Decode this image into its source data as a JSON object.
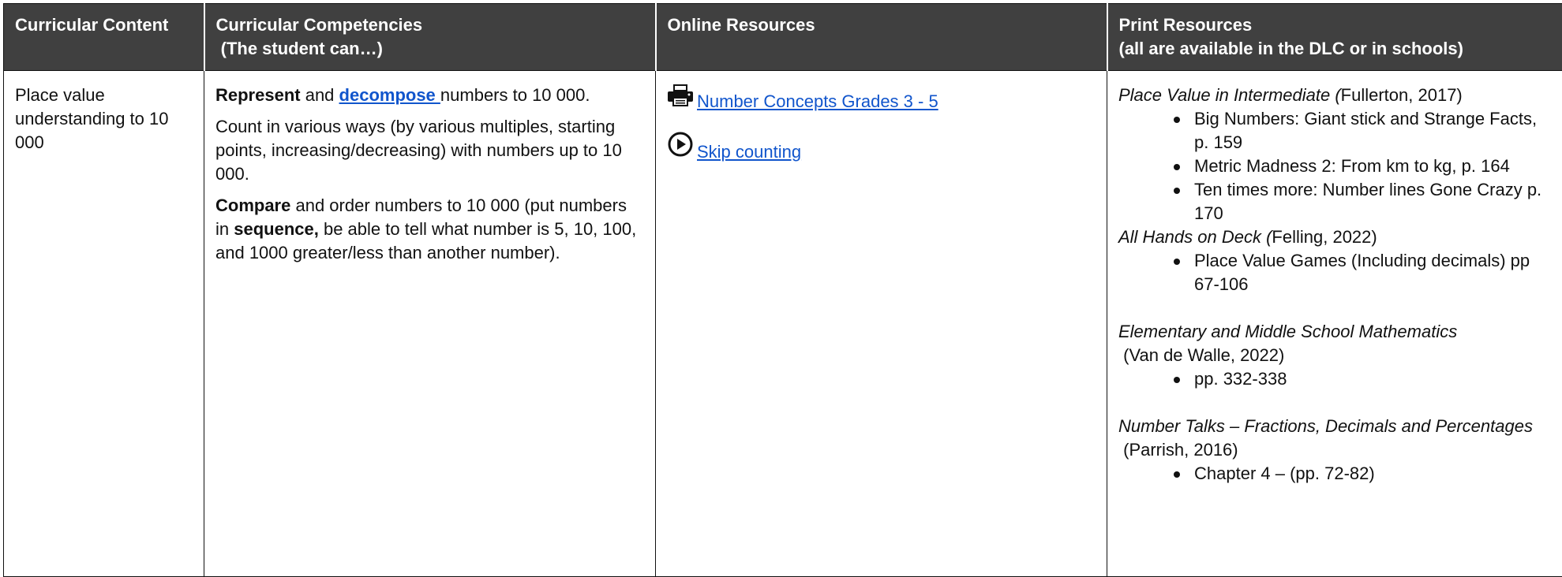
{
  "headers": {
    "content": "Curricular Content",
    "competencies_line1": "Curricular Competencies",
    "competencies_line2": " (The student can…)",
    "online": "Online Resources",
    "print_line1": "Print Resources",
    "print_line2": "(all are available in the DLC or in schools)"
  },
  "content": {
    "text": "Place value understanding to 10 000"
  },
  "competencies": {
    "p1_bold1": "Represent",
    "p1_and": " and ",
    "p1_link": "decompose ",
    "p1_rest": "numbers to 10 000.",
    "p2": "Count in various ways (by various multiples, starting points, increasing/decreasing) with numbers up to 10 000.",
    "p3_bold1": "Compare",
    "p3_mid": " and order numbers to 10 000 (put numbers in ",
    "p3_bold2": "sequence,",
    "p3_rest": " be able to tell what number is 5, 10, 100, and 1000 greater/less than another number)."
  },
  "online": {
    "items": [
      {
        "icon": "printer-icon",
        "label": "Number Concepts Grades 3 - 5"
      },
      {
        "icon": "play-circle-icon",
        "label": "Skip counting"
      }
    ]
  },
  "print": {
    "books": [
      {
        "title": "Place Value in Intermediate (",
        "cite": "Fullerton, 2017)",
        "items": [
          "Big Numbers: Giant stick and Strange Facts, p. 159",
          "Metric Madness 2: From km to kg, p. 164",
          "Ten times more: Number lines Gone Crazy p. 170"
        ]
      },
      {
        "title": "All Hands on Deck (",
        "cite": "Felling, 2022)",
        "items": [
          "Place Value Games (Including decimals) pp 67-106"
        ]
      },
      {
        "title": "Elementary and Middle School Mathematics",
        "cite": " (Van de Walle, 2022)",
        "items": [
          "pp. 332-338"
        ]
      },
      {
        "title": "Number Talks – Fractions, Decimals and Percentages",
        "cite": " (Parrish, 2016)",
        "items": [
          "Chapter 4 – (pp. 72-82)"
        ]
      }
    ]
  }
}
